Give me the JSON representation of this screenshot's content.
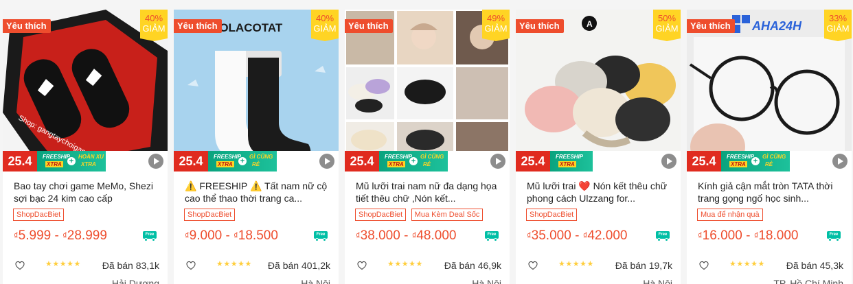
{
  "products": [
    {
      "badge_favorite": "Yêu thích",
      "discount_pct": "40%",
      "discount_label": "GIẢM",
      "promo": {
        "date": "25.4",
        "ship_line1": "FREESHIP",
        "ship_line2": "XTRA",
        "bonus_line1": "HOÀN XU",
        "bonus_line2": "XTRA"
      },
      "watermark": "Shop: gangtaychoigame",
      "name": "Bao tay chơi game MeMo, Shezi sợi bạc 24 kim cao cấp",
      "tags": [
        "ShopDacBiet"
      ],
      "price_currency": "₫",
      "price_min": "5.999",
      "price_sep": " - ",
      "price_max": "28.999",
      "free_label": "Free",
      "stars": "★★★★★",
      "sold": "Đã bán 83,1k",
      "location": "Hải Dương",
      "img_bg": "#1c1c1c"
    },
    {
      "badge_favorite": "Yêu thích",
      "discount_pct": "40%",
      "discount_label": "GIẢM",
      "promo": {
        "date": "25.4",
        "ship_line1": "FREESHIP",
        "ship_line2": "XTRA",
        "bonus_line1": "GÌ CŨNG",
        "bonus_line2": "RẺ"
      },
      "brand_text": "VOLACOTAT",
      "name": "⚠️ FREESHIP ⚠️ Tất nam nữ cộ cao thể thao thời trang ca...",
      "tags": [
        "ShopDacBiet"
      ],
      "price_currency": "₫",
      "price_min": "9.000",
      "price_sep": " - ",
      "price_max": "18.500",
      "free_label": "Free",
      "stars": "★★★★★",
      "sold": "Đã bán 401,2k",
      "location": "Hà Nội",
      "img_bg": "#a8d3ee"
    },
    {
      "badge_favorite": "Yêu thích",
      "discount_pct": "49%",
      "discount_label": "GIẢM",
      "promo": {
        "date": "25.4",
        "ship_line1": "FREESHIP",
        "ship_line2": "XTRA",
        "bonus_line1": "GÌ CŨNG",
        "bonus_line2": "RẺ"
      },
      "name": "Mũ lưỡi trai nam nữ đa dạng họa tiết thêu chữ ,Nón kết...",
      "tags": [
        "ShopDacBiet",
        "Mua Kèm Deal Sốc"
      ],
      "price_currency": "₫",
      "price_min": "38.000",
      "price_sep": " - ",
      "price_max": "48.000",
      "free_label": "Free",
      "stars": "★★★★★",
      "sold": "Đã bán 46,9k",
      "location": "Hà Nội",
      "img_bg": "#e8e3dc"
    },
    {
      "badge_favorite": "Yêu thích",
      "discount_pct": "50%",
      "discount_label": "GIẢM",
      "promo": {
        "date": "25.4",
        "ship_line1": "FREESHIP",
        "ship_line2": "XTRA"
      },
      "brand_text": "A",
      "name": "Mũ lưỡi trai ❤️ Nón kết thêu chữ phong cách Ulzzang for...",
      "tags": [
        "ShopDacBiet"
      ],
      "price_currency": "₫",
      "price_min": "35.000",
      "price_sep": " - ",
      "price_max": "42.000",
      "free_label": "Free",
      "stars": "★★★★★",
      "sold": "Đã bán 19,7k",
      "location": "Hà Nội",
      "img_bg": "#f2f2f0"
    },
    {
      "badge_favorite": "Yêu thích",
      "discount_pct": "33%",
      "discount_label": "GIẢM",
      "promo": {
        "date": "25.4",
        "ship_line1": "FREESHIP",
        "ship_line2": "XTRA",
        "bonus_line1": "GÌ CŨNG",
        "bonus_line2": "RẺ"
      },
      "brand_text": "AHA24H",
      "name": "Kính giả cận mắt tròn TATA thời trang gọng ngố học sinh...",
      "tags": [
        "Mua để nhận quà"
      ],
      "price_currency": "₫",
      "price_min": "16.000",
      "price_sep": " - ",
      "price_max": "18.000",
      "free_label": "Free",
      "stars": "★★★★★",
      "sold": "Đã bán 45,3k",
      "location": "TP. Hồ Chí Minh",
      "img_bg": "#e6e6e6"
    }
  ]
}
